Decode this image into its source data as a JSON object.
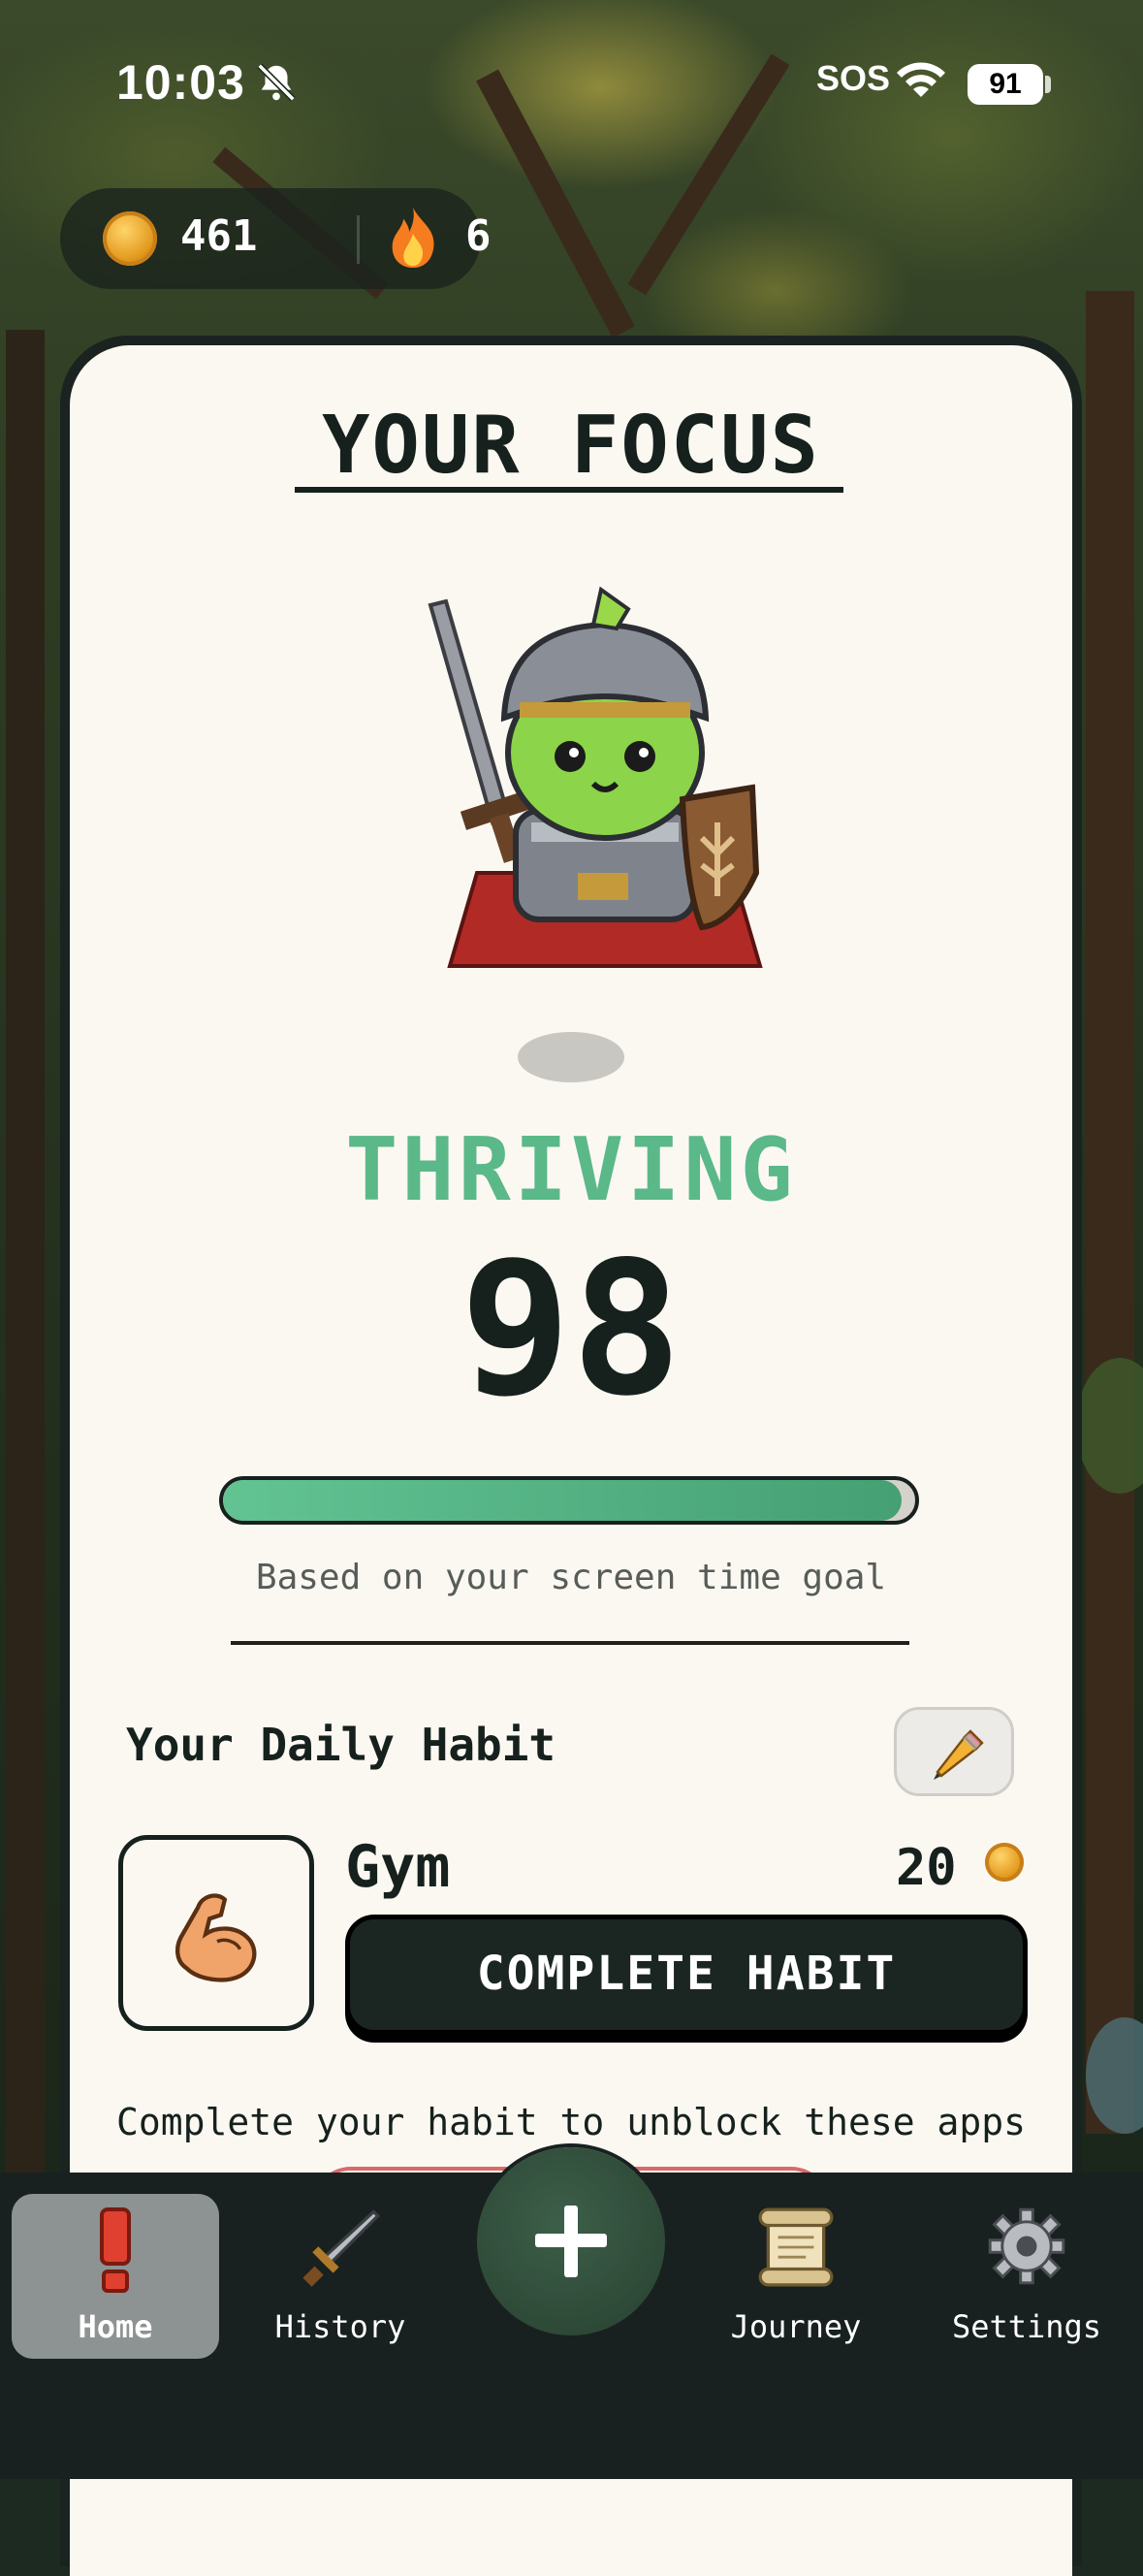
{
  "status_bar": {
    "time": "10:03",
    "sos": "SOS",
    "battery": "91"
  },
  "currency": {
    "coins": "461",
    "streak": "6"
  },
  "focus": {
    "title": "YOUR FOCUS",
    "status": "THRIVING",
    "score": "98",
    "progress_fraction": 0.98,
    "caption": "Based on your screen time goal"
  },
  "habit": {
    "heading": "Your Daily Habit",
    "name": "Gym",
    "reward": "20",
    "complete_label": "COMPLETE HABIT",
    "unblock_text": "Complete your habit to unblock these apps"
  },
  "nav": {
    "items": [
      {
        "label": "Home",
        "icon": "exclamation-icon"
      },
      {
        "label": "History",
        "icon": "sword-icon"
      },
      {
        "label": "Journey",
        "icon": "scroll-icon"
      },
      {
        "label": "Settings",
        "icon": "gear-icon"
      }
    ],
    "fab_icon": "plus-icon"
  },
  "colors": {
    "accent_green": "#5bb889",
    "dark": "#16211e",
    "card_bg": "#fbf8f2"
  }
}
